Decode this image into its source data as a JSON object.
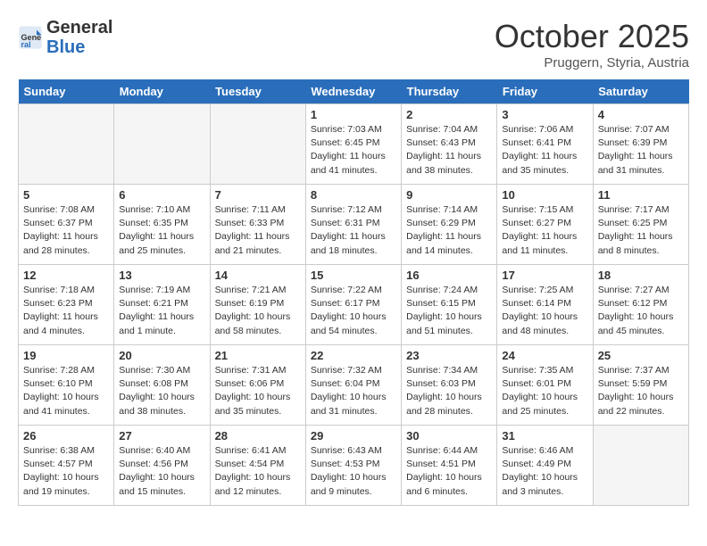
{
  "header": {
    "logo_general": "General",
    "logo_blue": "Blue",
    "month": "October 2025",
    "location": "Pruggern, Styria, Austria"
  },
  "days_of_week": [
    "Sunday",
    "Monday",
    "Tuesday",
    "Wednesday",
    "Thursday",
    "Friday",
    "Saturday"
  ],
  "weeks": [
    [
      {
        "day": "",
        "empty": true
      },
      {
        "day": "",
        "empty": true
      },
      {
        "day": "",
        "empty": true
      },
      {
        "day": "1",
        "sunrise": "7:03 AM",
        "sunset": "6:45 PM",
        "daylight": "11 hours and 41 minutes."
      },
      {
        "day": "2",
        "sunrise": "7:04 AM",
        "sunset": "6:43 PM",
        "daylight": "11 hours and 38 minutes."
      },
      {
        "day": "3",
        "sunrise": "7:06 AM",
        "sunset": "6:41 PM",
        "daylight": "11 hours and 35 minutes."
      },
      {
        "day": "4",
        "sunrise": "7:07 AM",
        "sunset": "6:39 PM",
        "daylight": "11 hours and 31 minutes."
      }
    ],
    [
      {
        "day": "5",
        "sunrise": "7:08 AM",
        "sunset": "6:37 PM",
        "daylight": "11 hours and 28 minutes."
      },
      {
        "day": "6",
        "sunrise": "7:10 AM",
        "sunset": "6:35 PM",
        "daylight": "11 hours and 25 minutes."
      },
      {
        "day": "7",
        "sunrise": "7:11 AM",
        "sunset": "6:33 PM",
        "daylight": "11 hours and 21 minutes."
      },
      {
        "day": "8",
        "sunrise": "7:12 AM",
        "sunset": "6:31 PM",
        "daylight": "11 hours and 18 minutes."
      },
      {
        "day": "9",
        "sunrise": "7:14 AM",
        "sunset": "6:29 PM",
        "daylight": "11 hours and 14 minutes."
      },
      {
        "day": "10",
        "sunrise": "7:15 AM",
        "sunset": "6:27 PM",
        "daylight": "11 hours and 11 minutes."
      },
      {
        "day": "11",
        "sunrise": "7:17 AM",
        "sunset": "6:25 PM",
        "daylight": "11 hours and 8 minutes."
      }
    ],
    [
      {
        "day": "12",
        "sunrise": "7:18 AM",
        "sunset": "6:23 PM",
        "daylight": "11 hours and 4 minutes."
      },
      {
        "day": "13",
        "sunrise": "7:19 AM",
        "sunset": "6:21 PM",
        "daylight": "11 hours and 1 minute."
      },
      {
        "day": "14",
        "sunrise": "7:21 AM",
        "sunset": "6:19 PM",
        "daylight": "10 hours and 58 minutes."
      },
      {
        "day": "15",
        "sunrise": "7:22 AM",
        "sunset": "6:17 PM",
        "daylight": "10 hours and 54 minutes."
      },
      {
        "day": "16",
        "sunrise": "7:24 AM",
        "sunset": "6:15 PM",
        "daylight": "10 hours and 51 minutes."
      },
      {
        "day": "17",
        "sunrise": "7:25 AM",
        "sunset": "6:14 PM",
        "daylight": "10 hours and 48 minutes."
      },
      {
        "day": "18",
        "sunrise": "7:27 AM",
        "sunset": "6:12 PM",
        "daylight": "10 hours and 45 minutes."
      }
    ],
    [
      {
        "day": "19",
        "sunrise": "7:28 AM",
        "sunset": "6:10 PM",
        "daylight": "10 hours and 41 minutes."
      },
      {
        "day": "20",
        "sunrise": "7:30 AM",
        "sunset": "6:08 PM",
        "daylight": "10 hours and 38 minutes."
      },
      {
        "day": "21",
        "sunrise": "7:31 AM",
        "sunset": "6:06 PM",
        "daylight": "10 hours and 35 minutes."
      },
      {
        "day": "22",
        "sunrise": "7:32 AM",
        "sunset": "6:04 PM",
        "daylight": "10 hours and 31 minutes."
      },
      {
        "day": "23",
        "sunrise": "7:34 AM",
        "sunset": "6:03 PM",
        "daylight": "10 hours and 28 minutes."
      },
      {
        "day": "24",
        "sunrise": "7:35 AM",
        "sunset": "6:01 PM",
        "daylight": "10 hours and 25 minutes."
      },
      {
        "day": "25",
        "sunrise": "7:37 AM",
        "sunset": "5:59 PM",
        "daylight": "10 hours and 22 minutes."
      }
    ],
    [
      {
        "day": "26",
        "sunrise": "6:38 AM",
        "sunset": "4:57 PM",
        "daylight": "10 hours and 19 minutes."
      },
      {
        "day": "27",
        "sunrise": "6:40 AM",
        "sunset": "4:56 PM",
        "daylight": "10 hours and 15 minutes."
      },
      {
        "day": "28",
        "sunrise": "6:41 AM",
        "sunset": "4:54 PM",
        "daylight": "10 hours and 12 minutes."
      },
      {
        "day": "29",
        "sunrise": "6:43 AM",
        "sunset": "4:53 PM",
        "daylight": "10 hours and 9 minutes."
      },
      {
        "day": "30",
        "sunrise": "6:44 AM",
        "sunset": "4:51 PM",
        "daylight": "10 hours and 6 minutes."
      },
      {
        "day": "31",
        "sunrise": "6:46 AM",
        "sunset": "4:49 PM",
        "daylight": "10 hours and 3 minutes."
      },
      {
        "day": "",
        "empty": true
      }
    ]
  ]
}
